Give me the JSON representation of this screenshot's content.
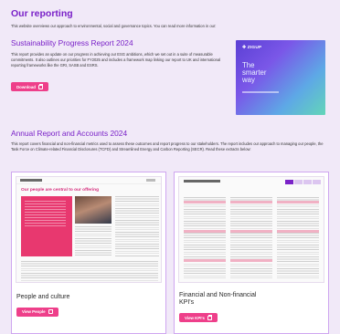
{
  "header": {
    "title": "Our reporting",
    "intro": "This website overviews our approach to environmental, social and governance topics. You can read more information in our:"
  },
  "sustainability": {
    "title": "Sustainability Progress Report 2024",
    "body": "This report provides an update on our progress in achieving our ESG ambitions, which we set out in a suite of measurable commitments. It also outlines our priorities for FY2025 and includes a framework map linking our report to UK and international reporting frameworks like the GRI, SASB and ESRS.",
    "button": "Download",
    "cover": {
      "logo": "✚ ZIGUP",
      "title_line1": "The",
      "title_line2": "smarter",
      "title_line3": "way"
    }
  },
  "annual": {
    "title": "Annual Report and Accounts 2024",
    "body": "This report covers financial and non-financial metrics used to assess these outcomes and report progress to our stakeholders. The report includes our approach to managing our people, the Task Force on Climate-related Financial Disclosures (TCFD) and Streamlined Energy and Carbon Reporting (SECR). Read these extracts below:"
  },
  "cards": [
    {
      "title": "People and culture",
      "button": "View People",
      "thumb_heading": "Our people are central to our offering"
    },
    {
      "title": "Financial and Non-financial KPI's",
      "button": "View KPI's"
    }
  ],
  "colors": {
    "accent_purple": "#7a22c8",
    "button_pink": "#ee3f8a",
    "page_bg": "#f1e9f8"
  }
}
